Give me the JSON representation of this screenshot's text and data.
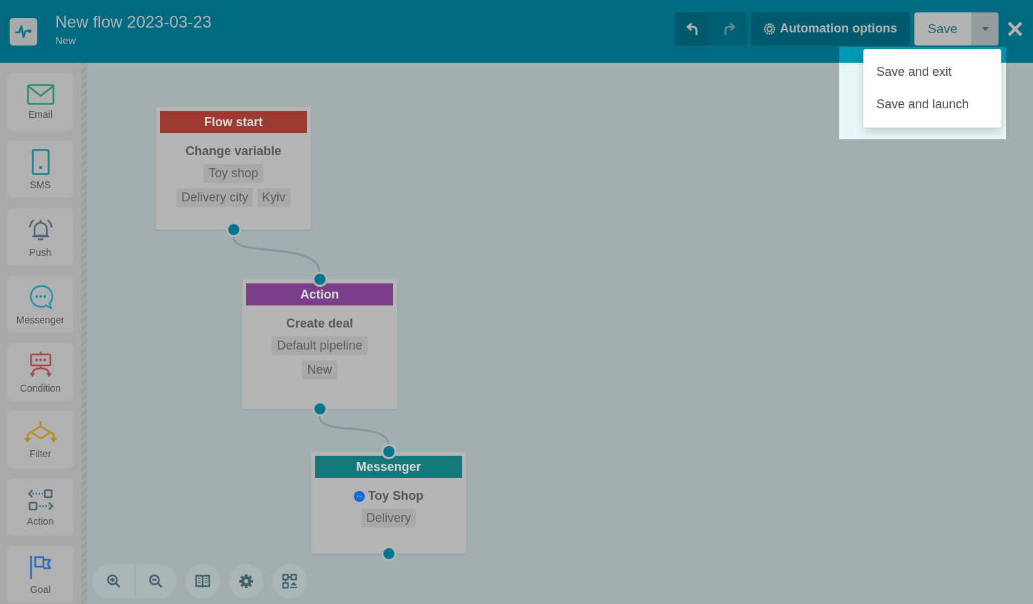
{
  "header": {
    "title": "New flow 2023-03-23",
    "subtitle": "New"
  },
  "toolbar": {
    "undo": {
      "disabled": false
    },
    "redo": {
      "disabled": true
    },
    "options_button": "Automation options",
    "save_button": "Save"
  },
  "save_menu": {
    "expanded": true,
    "items": [
      "Save and exit",
      "Save and launch"
    ]
  },
  "sidebar": {
    "items": [
      {
        "kind": "email",
        "label": "Email"
      },
      {
        "kind": "sms",
        "label": "SMS"
      },
      {
        "kind": "push",
        "label": "Push"
      },
      {
        "kind": "messenger",
        "label": "Messenger"
      },
      {
        "kind": "condition",
        "label": "Condition"
      },
      {
        "kind": "filter",
        "label": "Filter"
      },
      {
        "kind": "action",
        "label": "Action"
      },
      {
        "kind": "goal",
        "label": "Goal"
      }
    ]
  },
  "nodes": [
    {
      "kind": "start",
      "header": "Flow start",
      "title": "Change variable",
      "tag_rows": [
        [
          "Toy shop"
        ],
        [
          "Delivery city",
          "Kyiv"
        ]
      ]
    },
    {
      "kind": "action",
      "header": "Action",
      "title": "Create deal",
      "tag_rows": [
        [
          "Default pipeline"
        ],
        [
          "New"
        ]
      ]
    },
    {
      "kind": "messenger",
      "header": "Messenger",
      "title": "Toy Shop",
      "tag_rows": [
        [
          "Delivery"
        ]
      ]
    }
  ],
  "canvas_controls": [
    {
      "kind": "zoom-in"
    },
    {
      "kind": "zoom-out"
    },
    {
      "kind": "guide"
    },
    {
      "kind": "settings"
    },
    {
      "kind": "layout"
    }
  ]
}
